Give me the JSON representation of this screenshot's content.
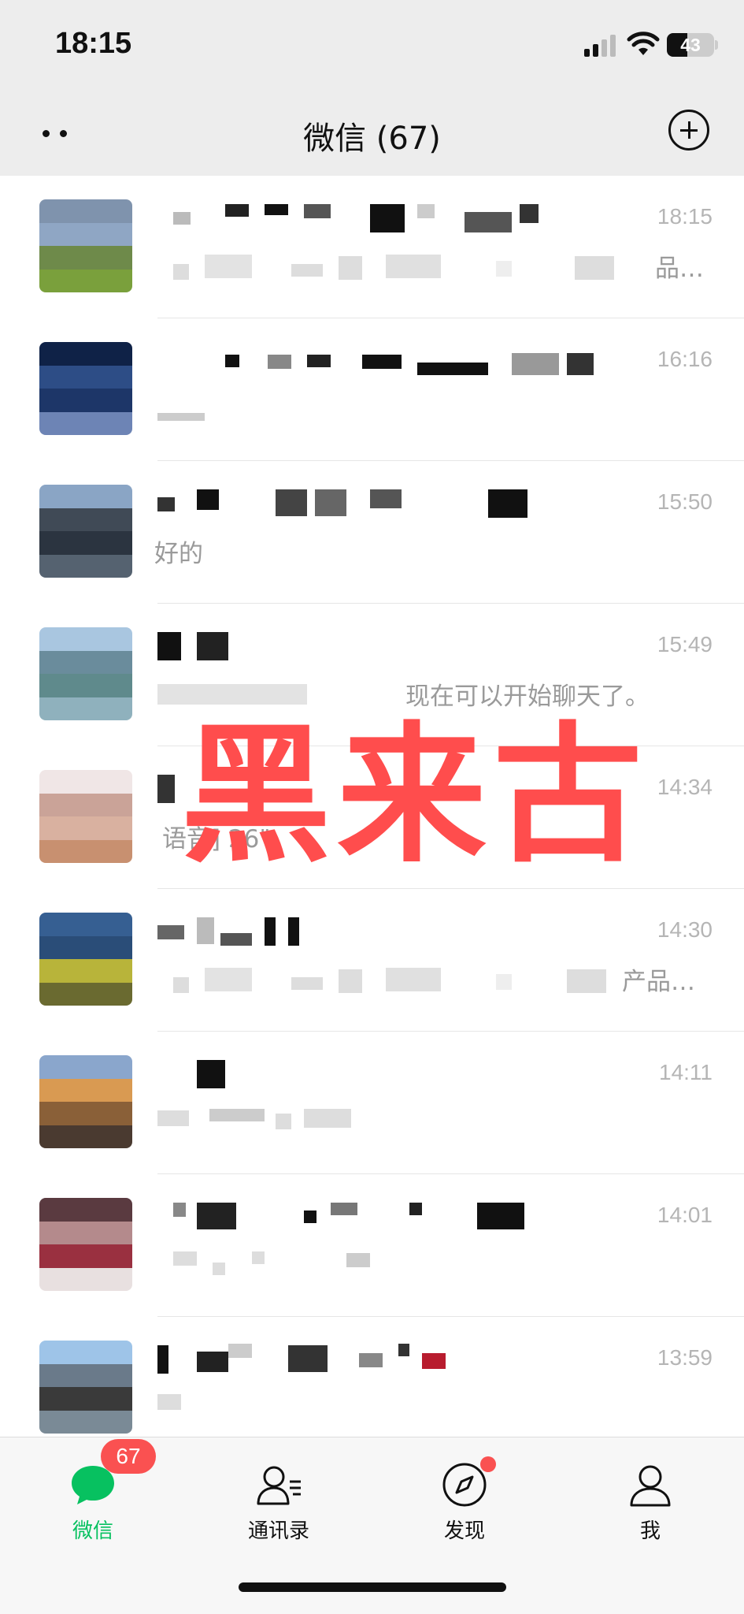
{
  "status_bar": {
    "time": "18:15",
    "battery": "43",
    "battery_level": 0.43
  },
  "nav": {
    "title": "微信 (67)"
  },
  "chats": [
    {
      "time": "18:15",
      "preview": "品…",
      "avatar_colors": [
        "#7f93ad",
        "#8fa6c4",
        "#6e8a4a",
        "#7aa03c"
      ]
    },
    {
      "time": "16:16",
      "preview": "",
      "avatar_colors": [
        "#0f2247",
        "#2d4d86",
        "#1d3668",
        "#6d84b5"
      ]
    },
    {
      "time": "15:50",
      "preview": "好的",
      "avatar_colors": [
        "#8aa5c5",
        "#404a56",
        "#2b3440",
        "#556270"
      ]
    },
    {
      "time": "15:49",
      "preview": "现在可以开始聊天了。",
      "avatar_colors": [
        "#a9c6e0",
        "#6a8c9c",
        "#5f8a8c",
        "#8fb1bd"
      ]
    },
    {
      "time": "14:34",
      "preview": "语音] 26\"",
      "avatar_colors": [
        "#f0e6e6",
        "#caa398",
        "#d9b1a0",
        "#c89070"
      ]
    },
    {
      "time": "14:30",
      "preview": "产品…",
      "avatar_colors": [
        "#365f92",
        "#2a4d78",
        "#b8b43a",
        "#6a6a30"
      ]
    },
    {
      "time": "14:11",
      "preview": "",
      "avatar_colors": [
        "#8aa6cc",
        "#d99a52",
        "#8a6038",
        "#4a3a30"
      ]
    },
    {
      "time": "14:01",
      "preview": "",
      "avatar_colors": [
        "#5a3a40",
        "#b48a8c",
        "#9a3040",
        "#e8e0e0"
      ]
    },
    {
      "time": "13:59",
      "preview": "",
      "avatar_colors": [
        "#9ec4e8",
        "#6a7a8a",
        "#3a3a3a",
        "#7a8a96"
      ]
    }
  ],
  "watermark": "黑来古",
  "tabs": [
    {
      "label": "微信",
      "icon": "chat-bubble-icon",
      "badge": "67",
      "active": true
    },
    {
      "label": "通讯录",
      "icon": "contacts-icon"
    },
    {
      "label": "发现",
      "icon": "compass-icon",
      "dot": true
    },
    {
      "label": "我",
      "icon": "person-icon"
    }
  ],
  "colors": {
    "accent": "#07c160",
    "badge": "#fa5151",
    "watermark": "#ff4d4d"
  }
}
